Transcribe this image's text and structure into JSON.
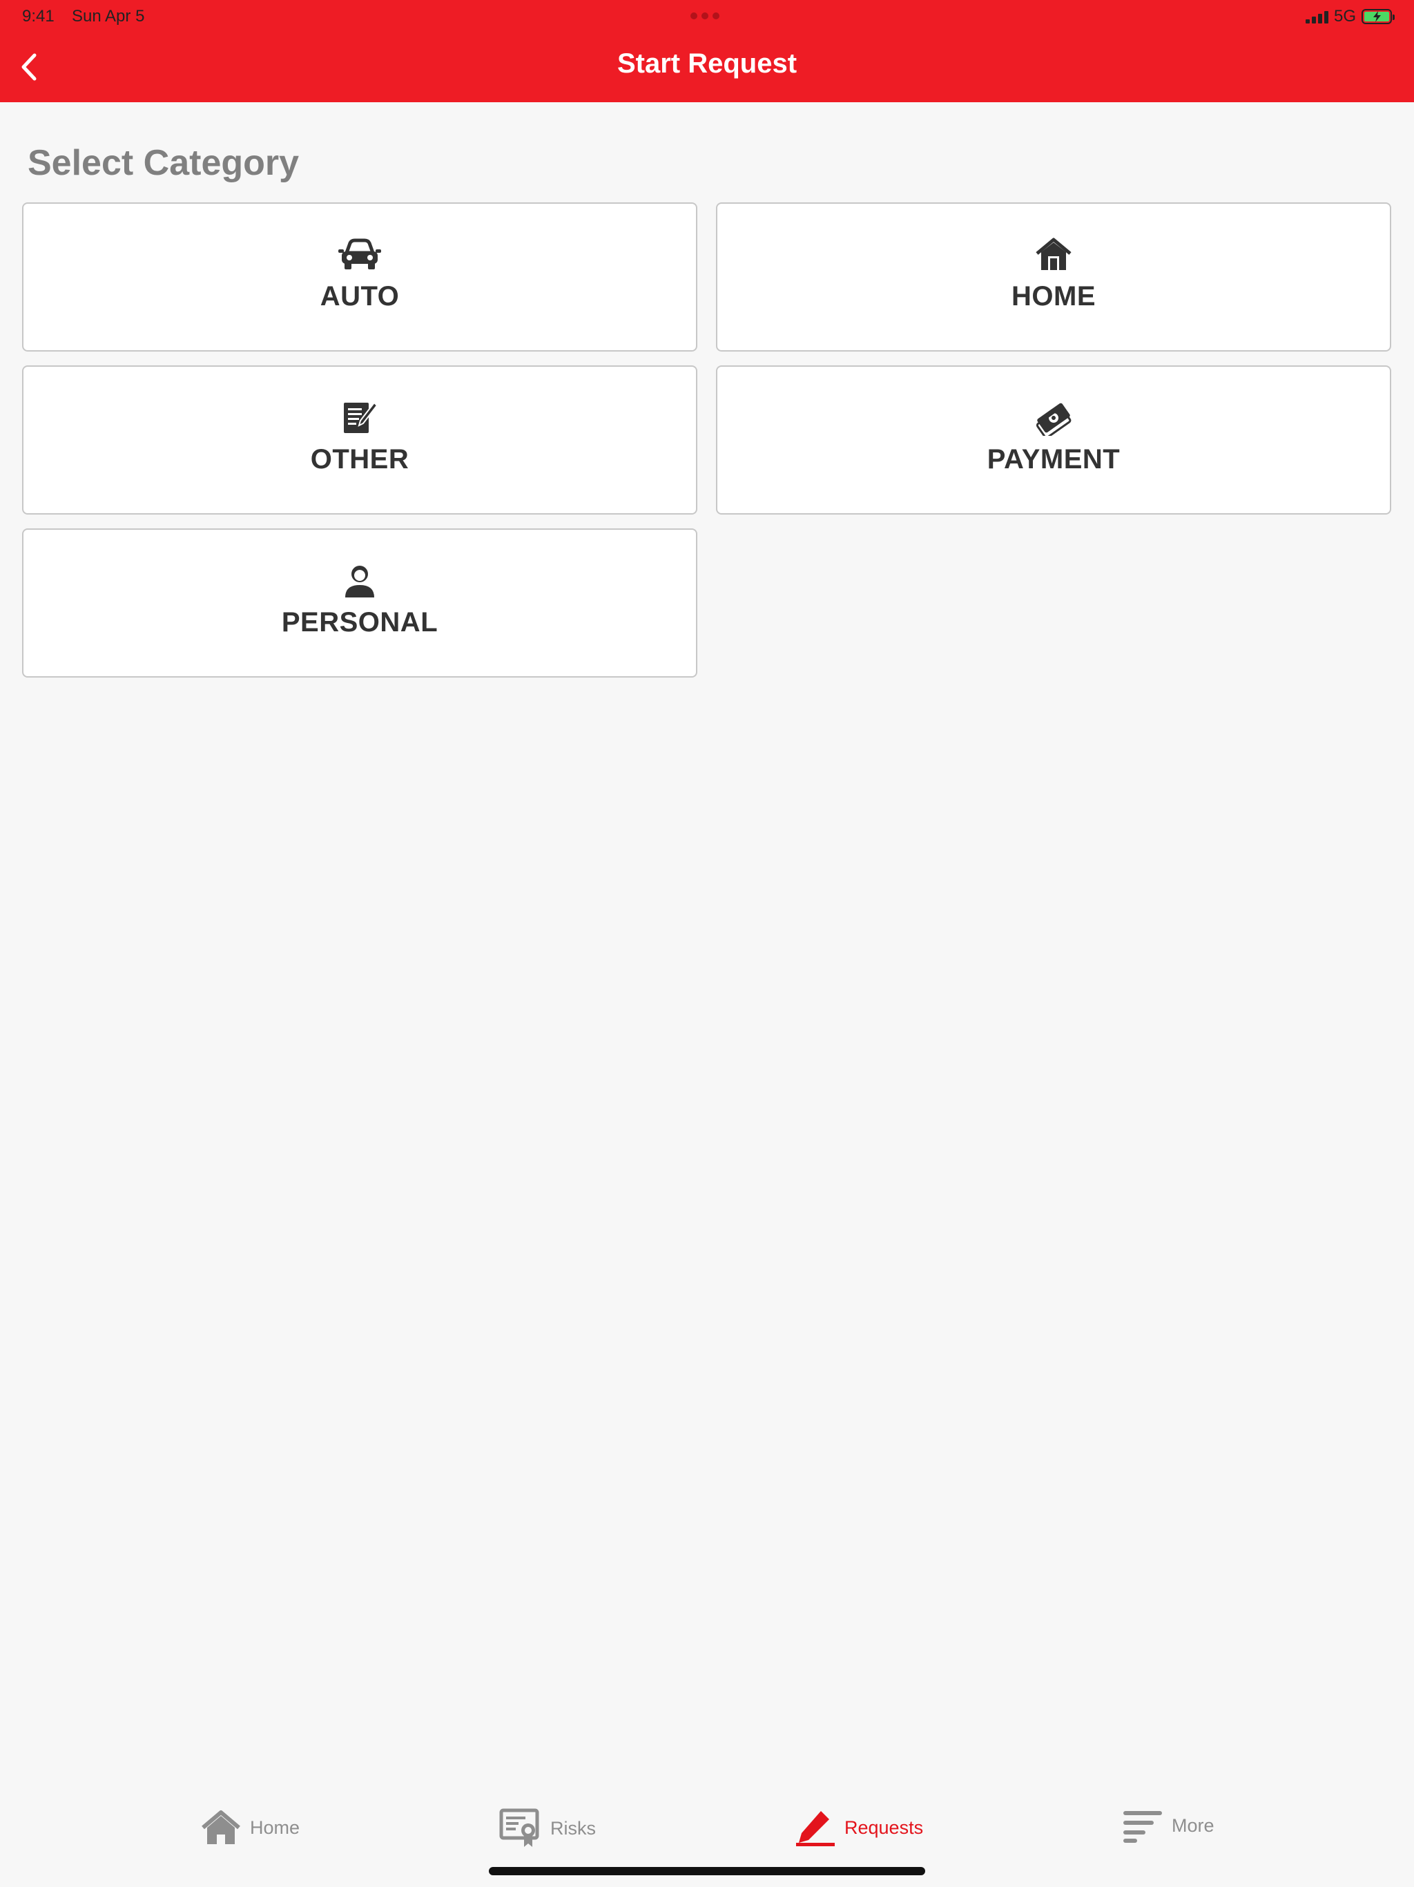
{
  "status": {
    "time": "9:41",
    "date": "Sun Apr 5",
    "network": "5G"
  },
  "nav": {
    "title": "Start Request",
    "back_icon": "chevron-left-icon"
  },
  "content": {
    "section_title": "Select Category",
    "categories": [
      {
        "label": "AUTO",
        "icon": "car-icon"
      },
      {
        "label": "HOME",
        "icon": "house-icon"
      },
      {
        "label": "OTHER",
        "icon": "document-edit-icon"
      },
      {
        "label": "PAYMENT",
        "icon": "money-icon"
      },
      {
        "label": "PERSONAL",
        "icon": "person-icon"
      }
    ]
  },
  "tabbar": {
    "items": [
      {
        "label": "Home",
        "icon": "home-icon",
        "active": false
      },
      {
        "label": "Risks",
        "icon": "certificate-icon",
        "active": false
      },
      {
        "label": "Requests",
        "icon": "pencil-icon",
        "active": true
      },
      {
        "label": "More",
        "icon": "menu-lines-icon",
        "active": false
      }
    ]
  },
  "colors": {
    "brand_red": "#ee1c25",
    "active_tab": "#e3141c",
    "inactive_tab": "#8e8e8e",
    "background": "#f7f7f7"
  }
}
